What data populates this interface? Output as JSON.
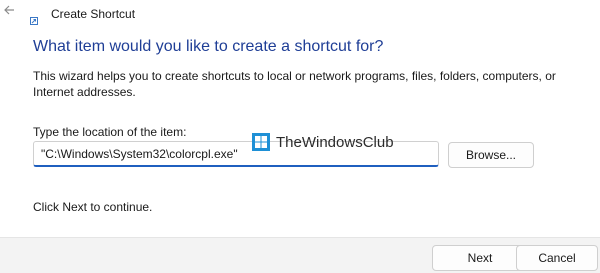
{
  "window": {
    "title": "Create Shortcut",
    "back_icon": "back-arrow-icon",
    "app_icon": "shortcut-app-icon"
  },
  "wizard": {
    "heading": "What item would you like to create a shortcut for?",
    "description": "This wizard helps you to create shortcuts to local or network programs, files, folders, computers, or Internet addresses.",
    "location_label": "Type the location of the item:",
    "location_value": "\"C:\\Windows\\System32\\colorcpl.exe\"",
    "browse_label": "Browse...",
    "continue_text": "Click Next to continue."
  },
  "watermark": {
    "text": "TheWindowsClub",
    "icon": "windows-club-logo-icon"
  },
  "footer": {
    "next_label": "Next",
    "cancel_label": "Cancel"
  },
  "colors": {
    "heading": "#1f3e96",
    "input_focus": "#1f5fbf",
    "footer_bg": "#f3f3f3",
    "logo_blue": "#1e90d6"
  }
}
